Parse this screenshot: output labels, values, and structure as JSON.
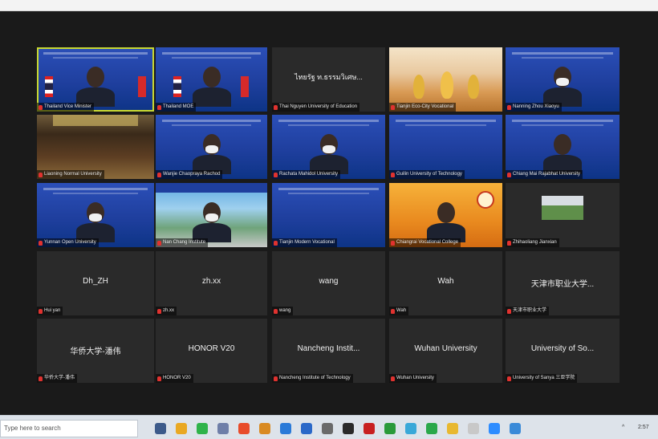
{
  "taskbar": {
    "search_placeholder": "Type here to search",
    "icons": [
      "task-view-icon",
      "chrome-icon",
      "line-icon",
      "file-icon",
      "office-icon",
      "store-icon",
      "edge-icon",
      "mail-icon",
      "calendar-icon",
      "terminal-icon",
      "app-red-icon",
      "xbox-icon",
      "photos-icon",
      "wechat-icon",
      "folder-icon",
      "notes-icon",
      "zoom-icon",
      "app-blue-icon"
    ],
    "tray_time": "2:57",
    "tray_extra": "^"
  },
  "tiles": [
    {
      "id": "t1",
      "style": "blue",
      "active": true,
      "label": "",
      "name": "Thailand Vice Minister"
    },
    {
      "id": "t2",
      "style": "blue",
      "active": false,
      "label": "",
      "name": "Thailand MOE"
    },
    {
      "id": "t3",
      "style": "dark",
      "active": false,
      "label": "ไทยรัฐ ท.ธรรมวิเศษ...",
      "name": "Thai Nguyen University of Education"
    },
    {
      "id": "t4",
      "style": "stage",
      "active": false,
      "label": "",
      "name": "Tianjin Eco-City Vocational"
    },
    {
      "id": "t5",
      "style": "blue",
      "active": false,
      "label": "",
      "name": "Nanning Zhou Xiaoyu"
    },
    {
      "id": "t6",
      "style": "hall",
      "active": false,
      "label": "",
      "name": "Liaoning Normal University"
    },
    {
      "id": "t7",
      "style": "blue",
      "active": false,
      "label": "",
      "name": "Wanjie Chaopraya Rachod"
    },
    {
      "id": "t8",
      "style": "blue",
      "active": false,
      "label": "",
      "name": "Rachata Mahidol University"
    },
    {
      "id": "t9",
      "style": "blue",
      "active": false,
      "label": "",
      "name": "Guilin University of Technology"
    },
    {
      "id": "t10",
      "style": "blue",
      "active": false,
      "label": "",
      "name": "Chiang Mai Rajabhat University"
    },
    {
      "id": "t11",
      "style": "blue",
      "active": false,
      "label": "",
      "name": "Yunnan Open University"
    },
    {
      "id": "t12",
      "style": "campus",
      "active": false,
      "label": "",
      "name": "Nan Chang Institute"
    },
    {
      "id": "t13",
      "style": "blue",
      "active": false,
      "label": "",
      "name": "Tianjin Modern Vocational"
    },
    {
      "id": "t14",
      "style": "orange",
      "active": false,
      "label": "",
      "name": "Chiangrai Vocational College"
    },
    {
      "id": "t15",
      "style": "photo",
      "active": false,
      "label": "",
      "name": "Zhihaoliang Jianxian"
    },
    {
      "id": "t16",
      "style": "dark",
      "active": false,
      "label": "Dh_ZH",
      "name": "Hui yan"
    },
    {
      "id": "t17",
      "style": "dark",
      "active": false,
      "label": "zh.xx",
      "name": "zh.xx"
    },
    {
      "id": "t18",
      "style": "dark",
      "active": false,
      "label": "wang",
      "name": "wang"
    },
    {
      "id": "t19",
      "style": "dark",
      "active": false,
      "label": "Wah",
      "name": "Wah"
    },
    {
      "id": "t20",
      "style": "dark",
      "active": false,
      "label": "天津市职业大学...",
      "name": "天津市职业大学"
    },
    {
      "id": "t21",
      "style": "dark",
      "active": false,
      "label": "华侨大学-潘伟",
      "name": "华侨大学-潘伟"
    },
    {
      "id": "t22",
      "style": "dark",
      "active": false,
      "label": "HONOR V20",
      "name": "HONOR V20"
    },
    {
      "id": "t23",
      "style": "dark",
      "active": false,
      "label": "Nancheng Instit...",
      "name": "Nancheng Institute of Technology"
    },
    {
      "id": "t24",
      "style": "dark",
      "active": false,
      "label": "Wuhan University",
      "name": "Wuhan University"
    },
    {
      "id": "t25",
      "style": "dark",
      "active": false,
      "label": "University of So...",
      "name": "University of Sanya 三亚学院"
    }
  ]
}
